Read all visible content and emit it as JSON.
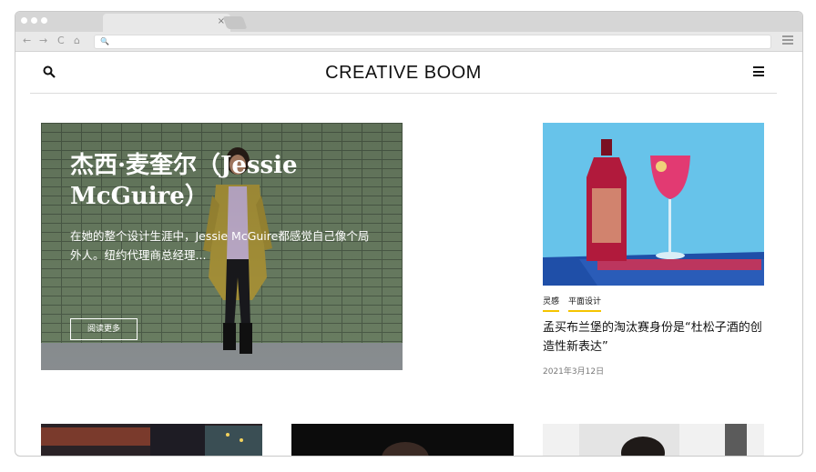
{
  "browser": {
    "tab_close": "×",
    "nav": {
      "back": "←",
      "forward": "→",
      "reload": "C",
      "home": "⌂"
    },
    "url_icon": "🔍"
  },
  "site": {
    "logo": "CREATIVE BOOM"
  },
  "hero": {
    "title": "杰西·麦奎尔（Jessie McGuire）",
    "excerpt": "在她的整个设计生涯中，Jessie McGuire都感觉自己像个局外人。纽约代理商总经理...",
    "button": "阅读更多"
  },
  "side_article": {
    "tags": [
      "灵感",
      "平面设计"
    ],
    "title": "孟买布兰堡的淘汰赛身份是“杜松子酒的创造性新表达”",
    "date": "2021年3月12日"
  },
  "colors": {
    "tag_underline": "#f5c400",
    "hero_overlay_text": "#ffffff"
  }
}
